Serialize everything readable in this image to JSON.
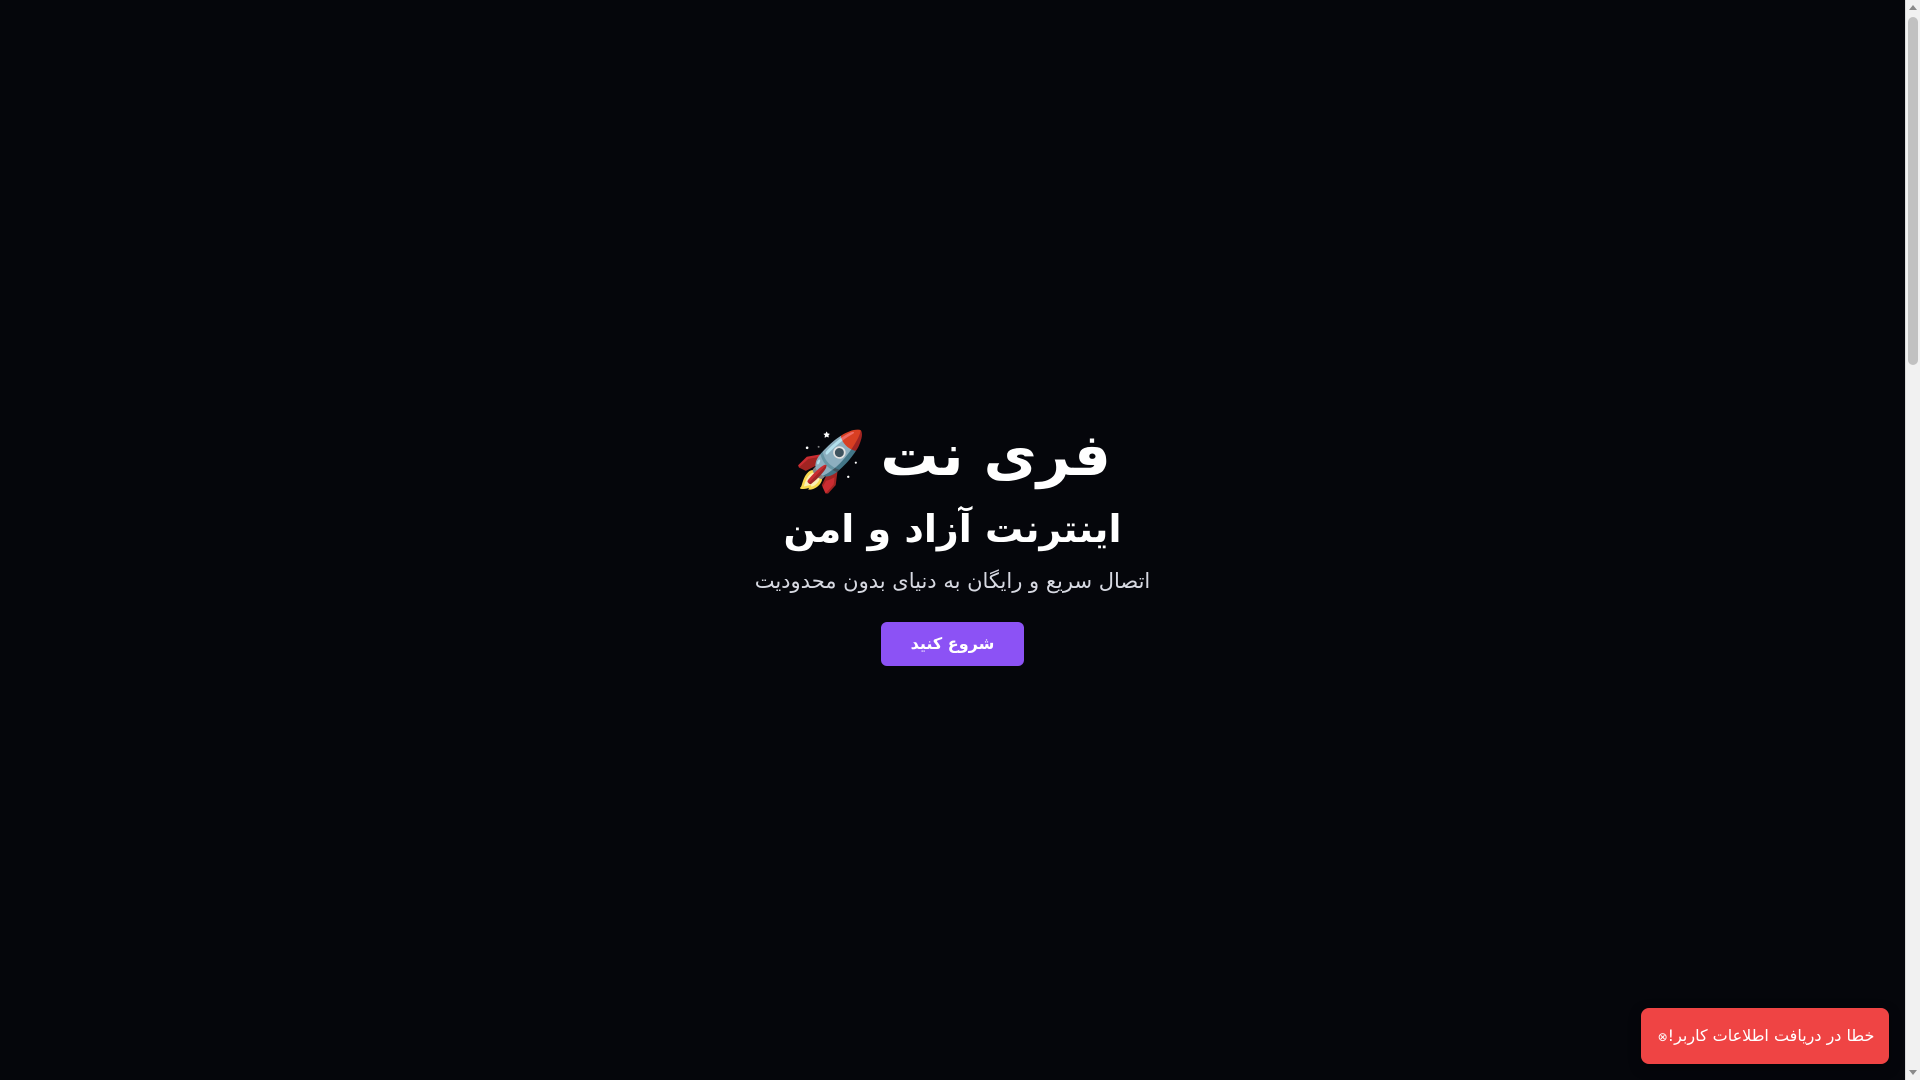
{
  "hero": {
    "title": "فری نت",
    "title_icon": "rocket-icon",
    "title_icon_glyph": "🚀",
    "subtitle": "اینترنت آزاد و امن",
    "tagline": "اتصال سریع و رایگان به دنیای بدون محدودیت",
    "cta_label": "شروع کنید"
  },
  "toast": {
    "message": "خطا در دریافت اطلاعات کاربر!",
    "icon": "error-icon",
    "icon_glyph": "⊗"
  },
  "colors": {
    "background": "#05060b",
    "accent": "#8c52f5",
    "toast_error": "#ef4444",
    "text_primary": "#ffffff",
    "text_secondary": "#d7d9e2"
  }
}
